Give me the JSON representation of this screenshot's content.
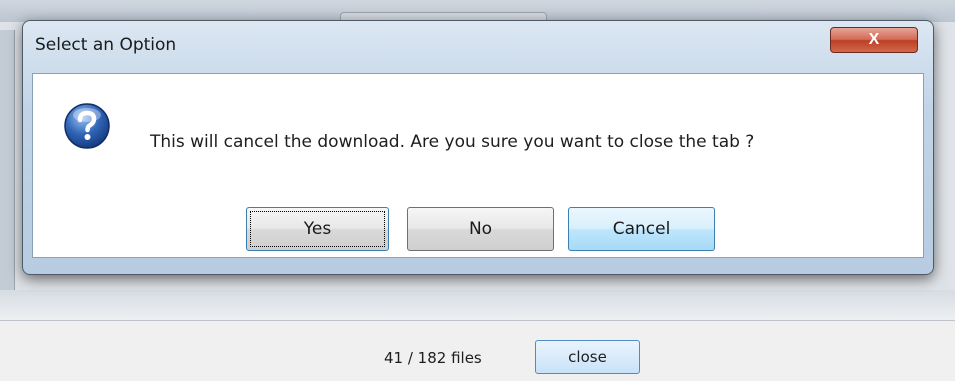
{
  "dialog": {
    "title": "Select an Option",
    "close_glyph": "X",
    "message": "This will cancel the download. Are you sure you want to close the tab ?",
    "icon": "question-icon",
    "buttons": {
      "yes": "Yes",
      "no": "No",
      "cancel": "Cancel"
    },
    "close_button_color": "#c94b34",
    "default_button": "yes"
  },
  "footer": {
    "file_count": "41 /  182 files",
    "close_label": "close"
  }
}
